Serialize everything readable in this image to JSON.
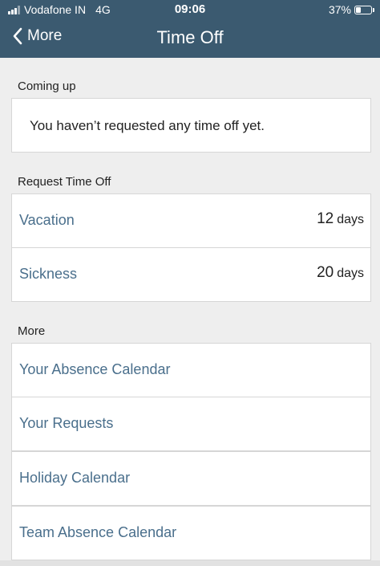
{
  "status_bar": {
    "carrier": "Vodafone IN",
    "network": "4G",
    "time": "09:06",
    "battery": "37%",
    "battery_level": 0.37
  },
  "nav": {
    "back_label": "More",
    "title": "Time Off"
  },
  "coming_up": {
    "heading": "Coming up",
    "message": "You haven’t requested any time off yet."
  },
  "request_time_off": {
    "heading": "Request Time Off",
    "items": [
      {
        "label": "Vacation",
        "count": "12",
        "unit": "days"
      },
      {
        "label": "Sickness",
        "count": "20",
        "unit": "days"
      }
    ]
  },
  "more": {
    "heading": "More",
    "items": [
      {
        "label": "Your Absence Calendar"
      },
      {
        "label": "Your Requests"
      },
      {
        "label": "Holiday Calendar"
      },
      {
        "label": "Team Absence Calendar"
      }
    ]
  },
  "colors": {
    "header_bg": "#3b5a70",
    "link_text": "#4a6f8c",
    "page_bg": "#eeeeee"
  }
}
